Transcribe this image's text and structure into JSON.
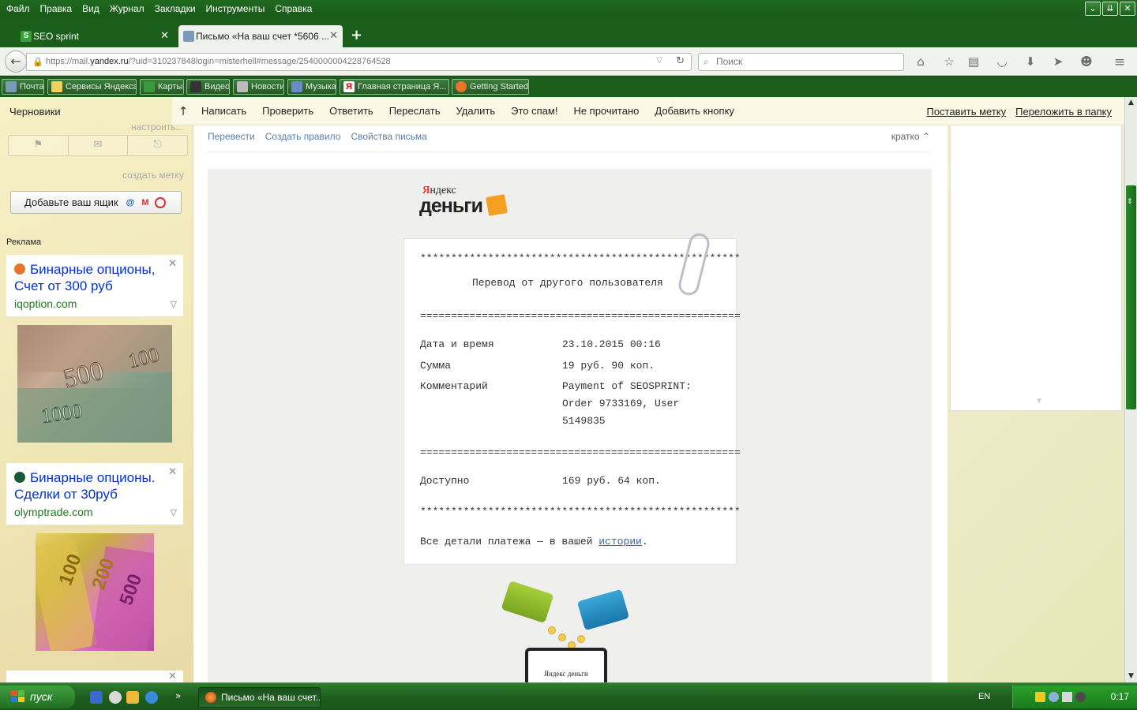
{
  "menubar": {
    "items": [
      "Файл",
      "Правка",
      "Вид",
      "Журнал",
      "Закладки",
      "Инструменты",
      "Справка"
    ],
    "window_buttons": [
      "chevron-down-icon",
      "double-chevron-icon",
      "close-icon"
    ]
  },
  "tabs": [
    {
      "label": "SEO sprint",
      "active": false
    },
    {
      "label": "Письмо «На ваш счет *5606 ...",
      "active": true
    }
  ],
  "navbar": {
    "url_prefix": "https://mail.",
    "url_domain": "yandex.ru",
    "url_suffix": "/?uid=310237848login=misterhell#message/2540000004228764528",
    "search_placeholder": "Поиск"
  },
  "bookmarks": [
    {
      "label": "Почта",
      "color": "#7a9ab8"
    },
    {
      "label": "Сервисы Яндекса",
      "color": "#f0d060"
    },
    {
      "label": "Карты",
      "color": "#3a9a3a"
    },
    {
      "label": "Видео",
      "color": "#333333"
    },
    {
      "label": "Новости",
      "color": "#bbbbbb"
    },
    {
      "label": "Музыка",
      "color": "#6a8ac8"
    },
    {
      "label": "Главная страница Я...",
      "color": "#ffffff"
    },
    {
      "label": "Getting Started",
      "color": "#e8742a"
    }
  ],
  "sidebar": {
    "drafts": "Черновики",
    "customize": "настроить...",
    "create_label": "создать метку",
    "add_box": "Добавьте ваш ящик",
    "ads_label": "Реклама"
  },
  "ads": [
    {
      "title": "Бинарные опционы, Счет от 300 руб",
      "domain": "iqoption.com",
      "icon_color": "#e8742a"
    },
    {
      "title": "Бинарные опционы. Сделки от 30руб",
      "domain": "olymptrade.com",
      "icon_color": "#1a5a3a"
    }
  ],
  "toolbar": {
    "buttons": [
      "Написать",
      "Проверить",
      "Ответить",
      "Переслать",
      "Удалить",
      "Это спам!",
      "Не прочитано",
      "Добавить кнопку"
    ],
    "right": [
      "Поставить метку",
      "Переложить в папку"
    ]
  },
  "message": {
    "actions": [
      "Перевести",
      "Создать правило",
      "Свойства письма"
    ],
    "brief": "кратко"
  },
  "logo": {
    "line1_first": "Я",
    "line1_rest": "ндекс",
    "line2": "деньги"
  },
  "receipt": {
    "stars": "****************************************************",
    "title": "Перевод от другого пользователя",
    "equals": "====================================================",
    "rows": [
      {
        "label": "Дата и время",
        "value": "23.10.2015 00:16"
      },
      {
        "label": "Сумма",
        "value": "19 руб. 90 коп."
      },
      {
        "label": "Комментарий",
        "value_lines": [
          "Payment of SEOSPRINT:",
          "Order 9733169, User",
          "5149835"
        ]
      }
    ],
    "available_label": "Доступно",
    "available_value": "169 руб. 64 коп.",
    "details_prefix": "Все детали платежа — в вашей ",
    "details_link": "истории",
    "details_suffix": "."
  },
  "laptop_logo": "Яндекс деньги",
  "taskbar": {
    "start": "пуск",
    "task_item": "Письмо «На ваш счет...",
    "lang": "EN",
    "clock": "0:17"
  }
}
